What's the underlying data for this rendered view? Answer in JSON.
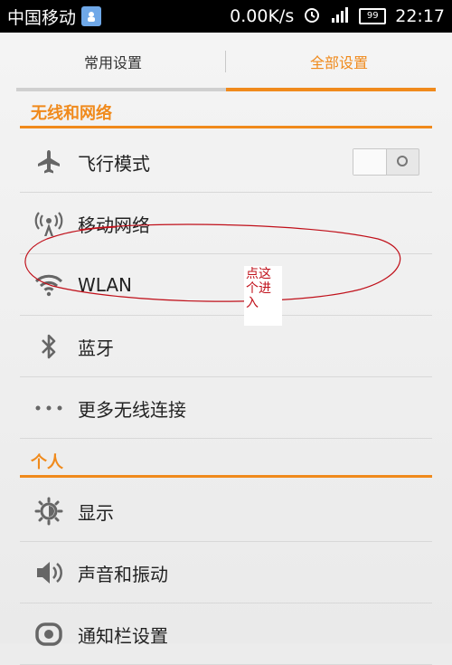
{
  "status_bar": {
    "carrier": "中国移动",
    "speed": "0.00K/s",
    "battery": "99",
    "time": "22:17"
  },
  "tabs": [
    {
      "label": "常用设置",
      "active": false
    },
    {
      "label": "全部设置",
      "active": true
    }
  ],
  "sections": {
    "wireless": {
      "title": "无线和网络",
      "items": [
        {
          "label": "飞行模式",
          "icon": "airplane-icon"
        },
        {
          "label": "移动网络",
          "icon": "antenna-icon"
        },
        {
          "label": "WLAN",
          "icon": "wifi-icon"
        },
        {
          "label": "蓝牙",
          "icon": "bluetooth-icon"
        },
        {
          "label": "更多无线连接",
          "icon": "more-dots-icon"
        }
      ]
    },
    "personal": {
      "title": "个人",
      "items": [
        {
          "label": "显示",
          "icon": "brightness-icon"
        },
        {
          "label": "声音和振动",
          "icon": "speaker-icon"
        },
        {
          "label": "通知栏设置",
          "icon": "notification-icon"
        }
      ]
    }
  },
  "annotation": {
    "note": "点这个进入"
  },
  "colors": {
    "accent": "#f08a1c",
    "annotation_red": "#c0101a"
  }
}
